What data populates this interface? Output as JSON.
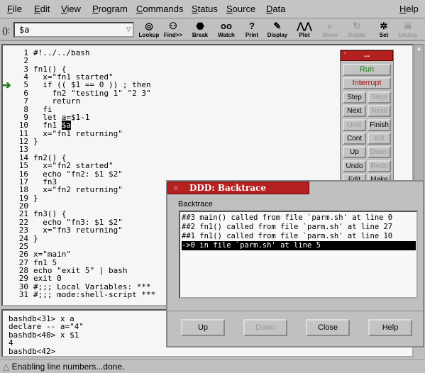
{
  "menu": [
    "File",
    "Edit",
    "View",
    "Program",
    "Commands",
    "Status",
    "Source",
    "Data",
    "Help"
  ],
  "arg": {
    "label": "():",
    "value": "$a"
  },
  "toolbar": [
    {
      "label": "Lookup",
      "icon": "lookup-icon",
      "enabled": true
    },
    {
      "label": "Find>>",
      "icon": "binoculars-icon",
      "enabled": true
    },
    {
      "label": "Break",
      "icon": "stop-sign-icon",
      "enabled": true
    },
    {
      "label": "Watch",
      "icon": "eyes-icon",
      "enabled": true
    },
    {
      "label": "Print",
      "icon": "question-icon",
      "enabled": true
    },
    {
      "label": "Display",
      "icon": "display-icon",
      "enabled": true
    },
    {
      "label": "Plot",
      "icon": "plot-icon",
      "enabled": true
    },
    {
      "label": "Show",
      "icon": "magnifier-icon",
      "enabled": false
    },
    {
      "label": "Rotate",
      "icon": "rotate-icon",
      "enabled": false
    },
    {
      "label": "Set",
      "icon": "gears-icon",
      "enabled": true
    },
    {
      "label": "Undisp",
      "icon": "skull-icon",
      "enabled": false
    }
  ],
  "source": [
    [
      "1",
      "#!../../bash"
    ],
    [
      "2",
      ""
    ],
    [
      "3",
      "fn1() {"
    ],
    [
      "4",
      "  x=\"fn1 started\""
    ],
    [
      "5",
      "  if (( $1 == 0 )) ; then"
    ],
    [
      "6",
      "    fn2 \"testing 1\" \"2 3\""
    ],
    [
      "7",
      "    return"
    ],
    [
      "8",
      "  fi"
    ],
    [
      "9",
      "  let a=$1-1"
    ],
    [
      "10",
      "  fn1 "
    ],
    [
      "11",
      "  x=\"fn1 returning\""
    ],
    [
      "12",
      "}"
    ],
    [
      "13",
      ""
    ],
    [
      "14",
      "fn2() {"
    ],
    [
      "15",
      "  x=\"fn2 started\""
    ],
    [
      "16",
      "  echo \"fn2: $1 $2\""
    ],
    [
      "17",
      "  fn3"
    ],
    [
      "18",
      "  x=\"fn2 returning\""
    ],
    [
      "19",
      "}"
    ],
    [
      "20",
      ""
    ],
    [
      "21",
      "fn3() {"
    ],
    [
      "22",
      "  echo \"fn3: $1 $2\""
    ],
    [
      "23",
      "  x=\"fn3 returning\""
    ],
    [
      "24",
      "}"
    ],
    [
      "25",
      ""
    ],
    [
      "26",
      "x=\"main\""
    ],
    [
      "27",
      "fn1 5"
    ],
    [
      "28",
      "echo \"exit 5\" | bash"
    ],
    [
      "29",
      "exit 0"
    ],
    [
      "30",
      "#;;; Local Variables: ***"
    ],
    [
      "31",
      "#;;; mode:shell-script ***"
    ]
  ],
  "selected_text": "$a",
  "current_line": "5",
  "console": [
    "bashdb<31> x a",
    "declare -- a=\"4\"",
    "bashdb<40> x $1",
    "4",
    "bashdb<42> "
  ],
  "status": "Enabling line numbers...done.",
  "cmdtool": {
    "title": "...",
    "run": "Run",
    "interrupt": "Interrupt",
    "buttons": [
      [
        "Step",
        true
      ],
      [
        "Stepi",
        false
      ],
      [
        "Next",
        true
      ],
      [
        "Nexti",
        false
      ],
      [
        "Until",
        false
      ],
      [
        "Finish",
        true
      ],
      [
        "Cont",
        true
      ],
      [
        "Kill",
        false
      ],
      [
        "Up",
        true
      ],
      [
        "Down",
        false
      ],
      [
        "Undo",
        true
      ],
      [
        "Redo",
        false
      ],
      [
        "Edit",
        true
      ],
      [
        "Make",
        true
      ]
    ]
  },
  "backtrace": {
    "title": "DDD: Backtrace",
    "label": "Backtrace",
    "frames": [
      "##3 main() called from file `parm.sh' at line 0",
      "##2 fn1() called from file `parm.sh' at line 27",
      "##1 fn1() called from file `parm.sh' at line 10",
      "->0 in file `parm.sh' at line 5"
    ],
    "selected": 3,
    "buttons": [
      [
        "Up",
        true
      ],
      [
        "Down",
        false
      ],
      [
        "Close",
        true
      ],
      [
        "Help",
        true
      ]
    ]
  },
  "colors": {
    "titlebar": "#b52020",
    "run": "#1a7a1a",
    "interrupt": "#b01010"
  }
}
